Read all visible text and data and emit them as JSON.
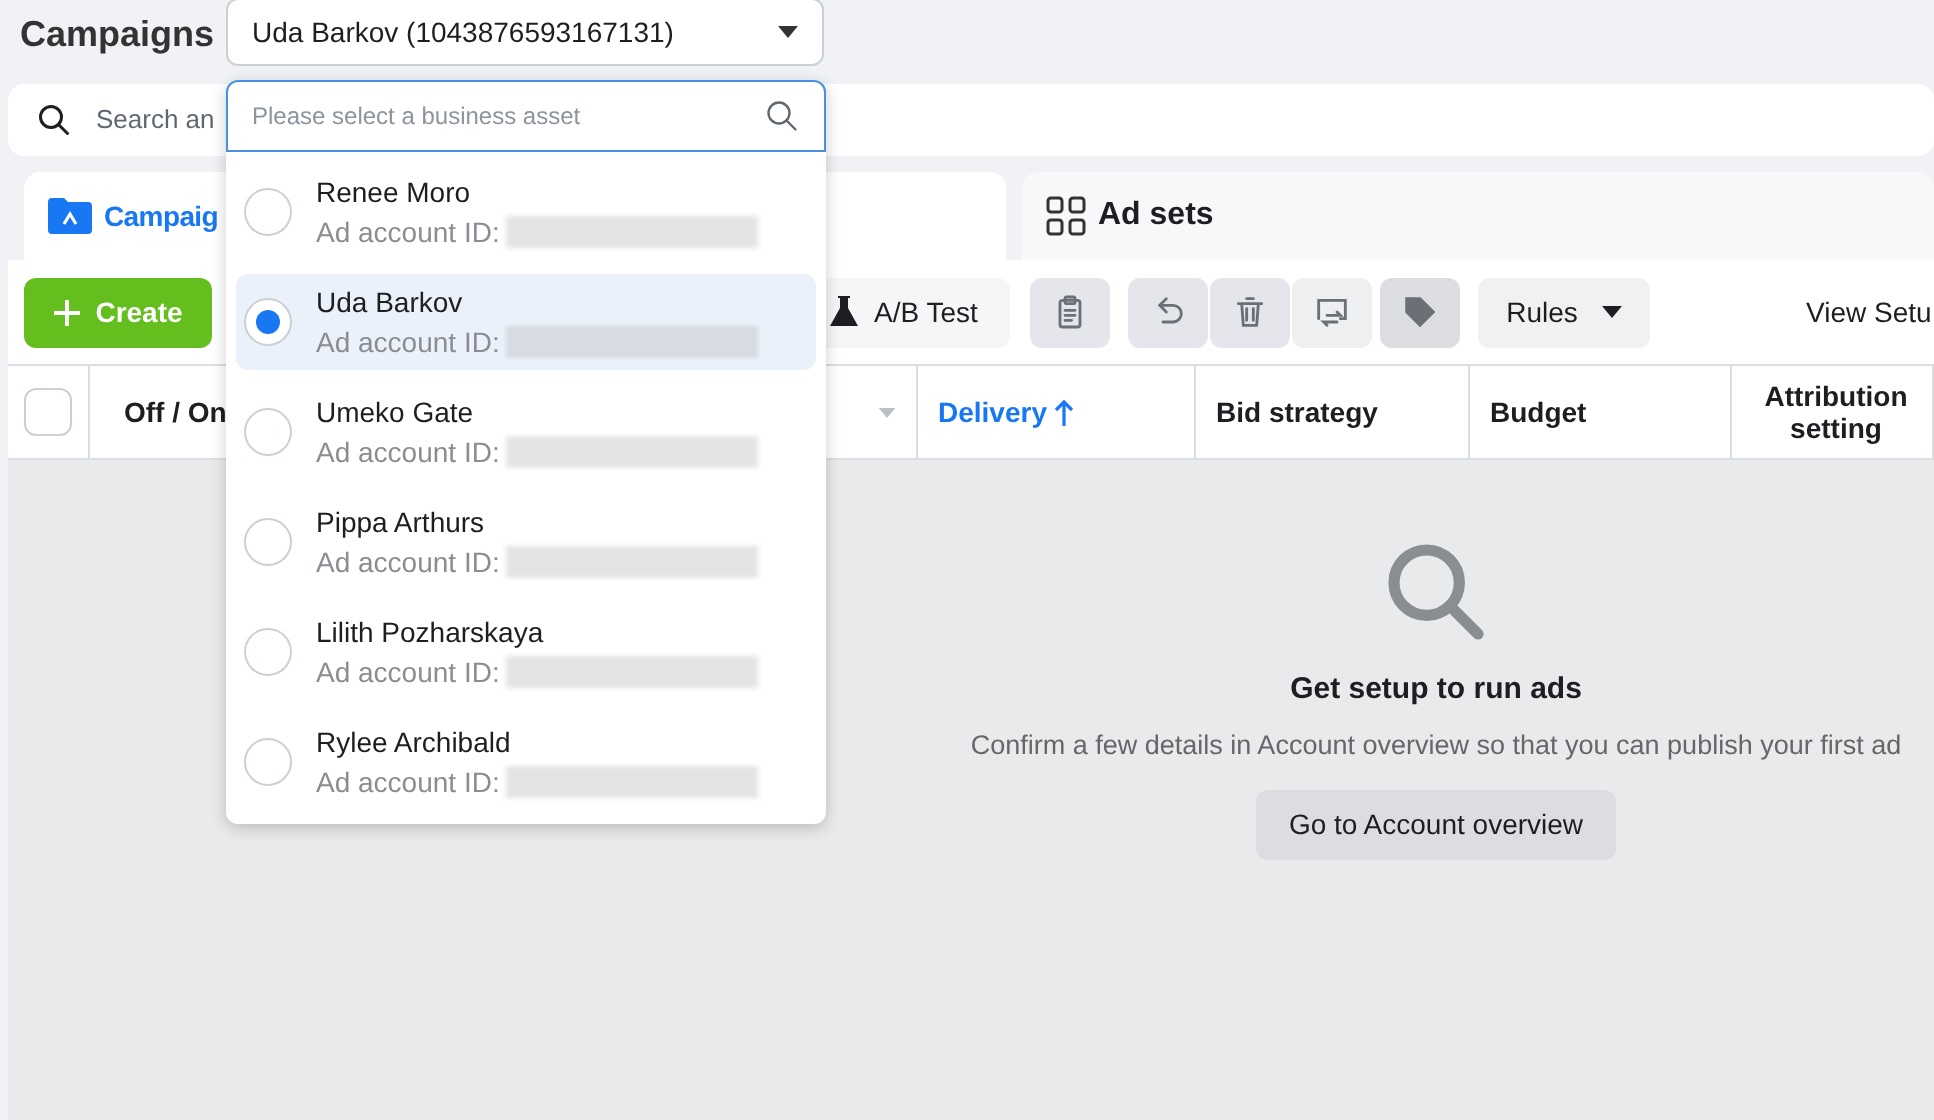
{
  "header": {
    "title": "Campaigns",
    "account_select": "Uda Barkov (1043876593167131)"
  },
  "search": {
    "placeholder": "Search an"
  },
  "tabs": [
    {
      "label": "Campaig",
      "selected": true
    },
    {
      "label": "Ad sets",
      "selected": false
    }
  ],
  "toolbar": {
    "create": "Create",
    "ab_test": "A/B Test",
    "rules": "Rules",
    "view_setup": "View Setu"
  },
  "table": {
    "select_all": {
      "checked": false
    },
    "columns": [
      {
        "label": "Off / On",
        "sorted": false
      },
      {
        "label": "Delivery",
        "sorted": true
      },
      {
        "label": "Bid strategy",
        "sorted": false
      },
      {
        "label": "Budget",
        "sorted": false
      },
      {
        "label": "Attribution setting",
        "sorted": false
      }
    ]
  },
  "empty_state": {
    "title": "Get setup to run ads",
    "message": "Confirm a few details in Account overview so that you can publish your first ad",
    "button": "Go to Account overview"
  },
  "dropdown": {
    "placeholder": "Please select a business asset",
    "items": [
      {
        "name": "Renee Moro",
        "id_label": "Ad account ID:",
        "selected": false
      },
      {
        "name": "Uda Barkov",
        "id_label": "Ad account ID:",
        "selected": true
      },
      {
        "name": "Umeko Gate",
        "id_label": "Ad account ID:",
        "selected": false
      },
      {
        "name": "Pippa Arthurs",
        "id_label": "Ad account ID:",
        "selected": false
      },
      {
        "name": "Lilith Pozharskaya",
        "id_label": "Ad account ID:",
        "selected": false
      },
      {
        "name": "Rylee Archibald",
        "id_label": "Ad account ID:",
        "selected": false
      }
    ]
  }
}
